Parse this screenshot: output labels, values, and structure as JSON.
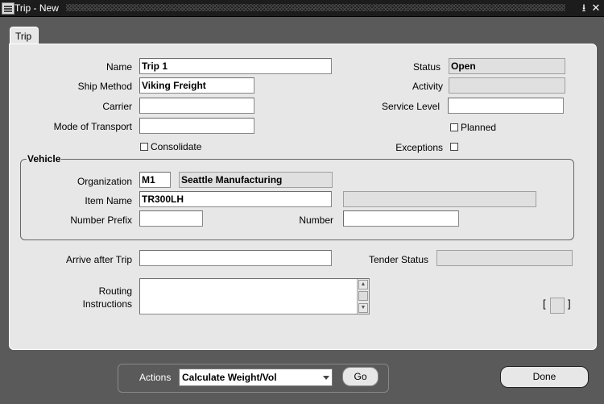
{
  "window": {
    "title": "Trip - New",
    "minimize": "⭳",
    "close": "✕"
  },
  "tabs": [
    {
      "label": "Trip"
    }
  ],
  "form": {
    "name": {
      "label": "Name",
      "value": "Trip 1"
    },
    "ship_method": {
      "label": "Ship Method",
      "value": "Viking Freight"
    },
    "carrier": {
      "label": "Carrier",
      "value": ""
    },
    "mode_of_transport": {
      "label": "Mode of Transport",
      "value": ""
    },
    "consolidate": {
      "label": "Consolidate",
      "checked": false
    },
    "status": {
      "label": "Status",
      "value": "Open"
    },
    "activity": {
      "label": "Activity",
      "value": ""
    },
    "service_level": {
      "label": "Service Level",
      "value": ""
    },
    "planned": {
      "label": "Planned",
      "checked": false
    },
    "exceptions": {
      "label": "Exceptions",
      "checked": false
    },
    "vehicle": {
      "title": "Vehicle",
      "organization": {
        "label": "Organization",
        "code": "M1",
        "name": "Seattle Manufacturing"
      },
      "item_name": {
        "label": "Item Name",
        "value": "TR300LH",
        "description": ""
      },
      "number_prefix": {
        "label": "Number Prefix",
        "value": ""
      },
      "number": {
        "label": "Number",
        "value": ""
      }
    },
    "arrive_after_trip": {
      "label": "Arrive after Trip",
      "value": ""
    },
    "tender_status": {
      "label": "Tender Status",
      "value": ""
    },
    "routing_instructions": {
      "label_line1": "Routing",
      "label_line2": "Instructions",
      "value": ""
    },
    "descriptive_flex": {
      "open": "[",
      "close": "]"
    }
  },
  "actions": {
    "label": "Actions",
    "selected": "Calculate Weight/Vol",
    "go_label": "Go",
    "done_label": "Done"
  }
}
